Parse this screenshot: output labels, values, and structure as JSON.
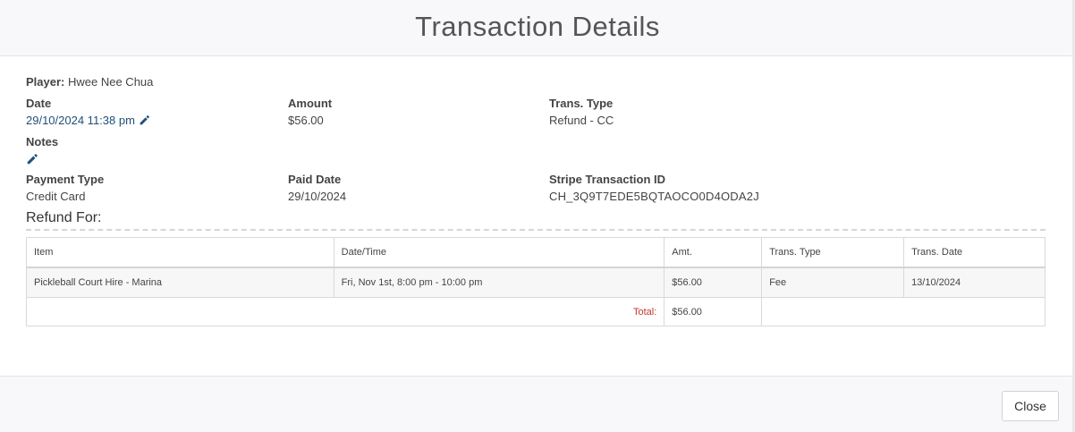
{
  "modal": {
    "title": "Transaction Details"
  },
  "player": {
    "label": "Player:",
    "name": "Hwee Nee Chua"
  },
  "fields": {
    "date": {
      "label": "Date",
      "value": "29/10/2024 11:38 pm"
    },
    "amount": {
      "label": "Amount",
      "value": "$56.00"
    },
    "trans_type": {
      "label": "Trans. Type",
      "value": "Refund - CC"
    },
    "notes": {
      "label": "Notes",
      "value": ""
    },
    "payment_type": {
      "label": "Payment Type",
      "value": "Credit Card"
    },
    "paid_date": {
      "label": "Paid Date",
      "value": "29/10/2024"
    },
    "stripe_id": {
      "label": "Stripe Transaction ID",
      "value": "CH_3Q9T7EDE5BQTAOCO0D4ODA2J"
    }
  },
  "refund": {
    "title": "Refund For:",
    "columns": [
      "Item",
      "Date/Time",
      "Amt.",
      "Trans. Type",
      "Trans. Date"
    ],
    "rows": [
      [
        "Pickleball Court Hire - Marina",
        "Fri, Nov 1st, 8:00 pm - 10:00 pm",
        "$56.00",
        "Fee",
        "13/10/2024"
      ]
    ],
    "total_label": "Total:",
    "total_value": "$56.00"
  },
  "footer": {
    "close_label": "Close"
  },
  "icons": {
    "edit": "pencil-icon"
  },
  "colors": {
    "link": "#1f4f7a",
    "total_label": "#c0392b",
    "header_bg": "#f8f8fa"
  }
}
